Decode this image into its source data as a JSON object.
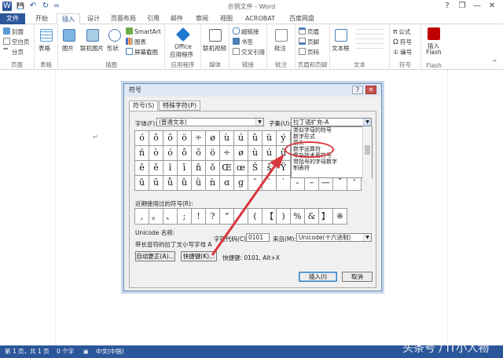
{
  "title_bar": {
    "title": "示例文件 - Word",
    "help": "?",
    "restore": "❐",
    "minimize": "—",
    "maximize": "□",
    "close": "✕"
  },
  "quick_access": {
    "word_icon": "W",
    "save_icon": "💾",
    "undo_icon": "↶",
    "redo_icon": "↻",
    "customize_icon": "="
  },
  "tabs": [
    "文件",
    "开始",
    "插入",
    "设计",
    "页面布局",
    "引用",
    "邮件",
    "审阅",
    "视图",
    "ACROBAT",
    "百度网盘"
  ],
  "active_tab": "插入",
  "ribbon": {
    "pages": {
      "items": [
        "封面",
        "空白页",
        "分页"
      ],
      "label": "页面"
    },
    "tables": {
      "table": "表格",
      "label": "表格"
    },
    "illustrations": {
      "picture": "图片",
      "online_picture": "联机图片",
      "shapes": "形状",
      "smartart": "SmartArt",
      "chart": "图表",
      "screenshot": "屏幕截图",
      "label": "插图"
    },
    "apps": {
      "office": "Office",
      "office2": "应用程序",
      "label": "应用程序"
    },
    "media": {
      "online_video": "联机视频",
      "label": "媒体"
    },
    "links": {
      "hyperlink": "超链接",
      "bookmark": "书签",
      "crossref": "交叉引用",
      "label": "链接"
    },
    "comments": {
      "comment": "批注",
      "label": "批注"
    },
    "header_footer": {
      "header": "页眉",
      "footer": "页脚",
      "page_number": "页码",
      "label": "页眉和页脚"
    },
    "text": {
      "textbox": "文本框",
      "label": "文本"
    },
    "symbols": {
      "equation": "公式",
      "symbol": "符号",
      "numbering": "编号",
      "label": "符号"
    },
    "flash": {
      "insert": "插入",
      "flash": "Flash",
      "label": "Flash"
    }
  },
  "dialog": {
    "title": "符号",
    "help_btn": "?",
    "close_btn": "✕",
    "tabs": [
      "符号(S)",
      "特殊字符(P)"
    ],
    "font_label": "字体(F):",
    "font_value": "(普通文本)",
    "subset_label": "子集(U):",
    "subset_value": "拉丁语扩充-A",
    "subset_list": [
      "类似字母的符号",
      "数字形式",
      "箭头",
      "数学运算符",
      "零杂技术用符号",
      "带括号的字母数字",
      "制表符"
    ],
    "symbols": [
      [
        "ó",
        "ô",
        "õ",
        "ö",
        "÷",
        "ø",
        "ù",
        "ú",
        "û",
        "ü",
        "ý",
        "þ",
        "ÿ",
        "Ā",
        "ā",
        "Ă"
      ],
      [
        "ñ",
        "ò",
        "ó",
        "ô",
        "õ",
        "ö",
        "÷",
        "ø",
        "ù",
        "ú",
        "û",
        "ü",
        "ý",
        "þ",
        "ÿ",
        "Ā"
      ],
      [
        "ē",
        "ě",
        "ĩ",
        "ī",
        "ň",
        "ŏ",
        "Œ",
        "œ",
        "Š",
        "š",
        "Ÿ",
        "Ž",
        "ž",
        "ƒ",
        "ˆ",
        "ˇ"
      ],
      [
        "ŭ",
        "ū",
        "ů",
        "ǔ",
        "ǜ",
        "ǹ",
        "ɑ",
        "ɡ",
        "ˉ",
        "ˋ",
        "˙",
        "‐",
        "–",
        "—",
        "˝",
        "‘"
      ]
    ],
    "recent_label": "近期使用过的符号(R):",
    "recent": [
      ",",
      "。",
      "、",
      ";",
      "!",
      "?",
      "“",
      "”",
      "(",
      "【",
      ")",
      "%",
      "&",
      "】",
      "※"
    ],
    "unicode_name_label": "Unicode 名称:",
    "unicode_name": "带长音符的拉丁文小写字母 A",
    "charcode_label": "字符代码(C):",
    "charcode_value": "0101",
    "from_label": "来自(M):",
    "from_value": "Unicode(十六进制)",
    "autocorrect_btn": "自动更正(A)...",
    "shortcut_btn": "快捷键(K)...",
    "shortcut_text": "快捷键: 0101, Alt+X",
    "insert_btn": "插入(I)",
    "cancel_btn": "取消"
  },
  "status": {
    "page": "第 1 页，共 1 页",
    "words": "0 个字",
    "lang": "中文(中国)"
  },
  "watermark": "头条号 / IT小人物",
  "colors": {
    "accent": "#2b579a",
    "highlight": "#d9363e"
  }
}
